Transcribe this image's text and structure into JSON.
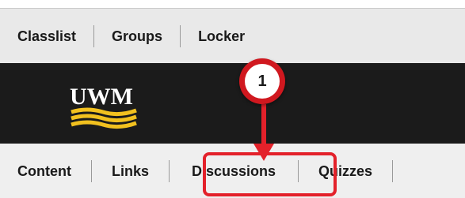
{
  "top_nav": {
    "items": [
      "Classlist",
      "Groups",
      "Locker"
    ]
  },
  "header": {
    "logo_text": "UWM"
  },
  "bottom_nav": {
    "items": [
      "Content",
      "Links",
      "Discussions",
      "Quizzes"
    ]
  },
  "callout": {
    "number": "1"
  },
  "colors": {
    "header_background": "#1b1b1b",
    "logo_gold": "#f2c11f",
    "callout_red": "#d0181f",
    "highlight_red": "#e3212a"
  }
}
